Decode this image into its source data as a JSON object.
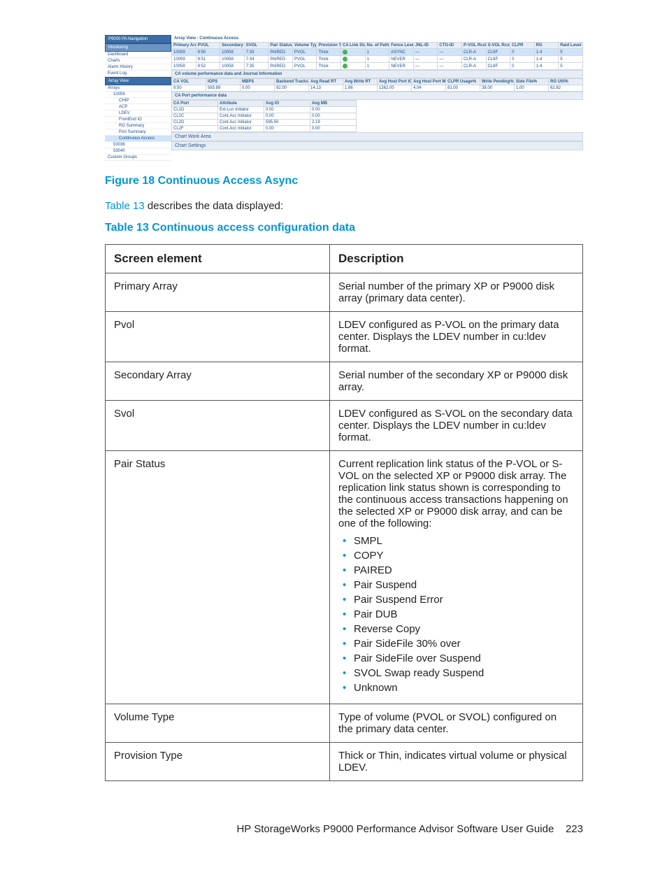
{
  "screenshot": {
    "nav_header": "P9000 PA Navigation",
    "monitoring": "Monitoring",
    "nav_items": [
      "Dashboard",
      "Charts",
      "Alarm History",
      "Event Log"
    ],
    "array_view": "Array View",
    "arrays_label": "Arrays",
    "array_root": "10059",
    "tree": [
      "CHIP",
      "ACP",
      "LDEV",
      "FrontEnd IO",
      "RG Summary",
      "Port Summary"
    ],
    "tree_sel": "Continuous Access",
    "others": [
      "53036",
      "53040"
    ],
    "custom_groups": "Custom Groups",
    "main_title": "Array View - Continuous Access",
    "top_headers": [
      "Primary Array",
      "PVOL",
      "Secondary Array",
      "SVOL",
      "Pair Status",
      "Volume Type",
      "Provision Type",
      "CA Link Status",
      "No. of Paths",
      "Fence Level",
      "JNL-ID",
      "CTG-ID",
      "P-VOL Rcst",
      "S-VOL Rcst",
      "CLPR",
      "RG",
      "Raid Level"
    ],
    "top_rows": [
      [
        "10059",
        "9:50",
        "10058",
        "7:33",
        "PAIRED",
        "PVOL",
        "Thick",
        "OK",
        "1",
        "ASYNC",
        "—",
        "—",
        "CLR-A",
        "CL6F",
        "0",
        "1-4",
        "5"
      ],
      [
        "10059",
        "9:51",
        "10058",
        "7:34",
        "PAIRED",
        "PVOL",
        "Thick",
        "OK",
        "1",
        "NEVER",
        "—",
        "—",
        "CLR-A",
        "CL6F",
        "0",
        "1-4",
        "5"
      ],
      [
        "10059",
        "9:52",
        "10058",
        "7:35",
        "PAIRED",
        "PVOL",
        "Thick",
        "OK",
        "1",
        "NEVER",
        "—",
        "—",
        "CLR-A",
        "CL6F",
        "0",
        "1-4",
        "5"
      ]
    ],
    "vol_title": "CA volume performance data and Journal Information",
    "vol_headers": [
      "CA VOL",
      "IOPS",
      "MBPS",
      "Backend Tracks",
      "Avg Read RT",
      "Avg Write RT",
      "Avg Host Port IO",
      "Avg Host Port MB",
      "CLPR Usage%",
      "Write Pending%",
      "Side File%",
      "RG Util%"
    ],
    "vol_row": [
      "9:50",
      "583.89",
      "0.00",
      "92.00",
      "14.13",
      "1.66",
      "1262.00",
      "4.04",
      "81.00",
      "38.00",
      "1.00",
      "62.82"
    ],
    "port_title": "CA Port performance data",
    "port_headers": [
      "CA Port",
      "Attribute",
      "Avg IO",
      "Avg MB"
    ],
    "port_rows": [
      [
        "CL1D",
        "Ext-Lun Initiator",
        "0.00",
        "0.00"
      ],
      [
        "CL2C",
        "Cont.Acc Initiator",
        "0.00",
        "0.00"
      ],
      [
        "CL2D",
        "Cont.Acc Initiator",
        "595.50",
        "2.19"
      ],
      [
        "CL2F",
        "Cont.Acc Initiator",
        "0.00",
        "0.00"
      ]
    ],
    "chart_work_area": "Chart Work Area",
    "chart_settings": "Chart Settings"
  },
  "figure_caption": "Figure 18 Continuous Access Async",
  "intro_link": "Table 13",
  "intro_rest": " describes the data displayed:",
  "table_caption": "Table 13 Continuous access configuration data",
  "table_head_left": "Screen element",
  "table_head_right": "Description",
  "rows": [
    {
      "name": "Primary Array",
      "desc": "Serial number of the primary XP or P9000 disk array (primary data center)."
    },
    {
      "name": "Pvol",
      "desc": "LDEV configured as P-VOL on the primary data center. Displays the LDEV number in cu:ldev format."
    },
    {
      "name": "Secondary Array",
      "desc": "Serial number of the secondary XP or P9000 disk array."
    },
    {
      "name": "Svol",
      "desc": "LDEV configured as S-VOL on the secondary data center. Displays the LDEV number in cu:ldev format."
    },
    {
      "name": "Pair Status",
      "desc": "Current replication link status of the P-VOL or S-VOL on the selected XP or P9000 disk array. The replication link status shown is corresponding to the continuous access transactions happening on the selected XP or P9000 disk array, and can be one of the following:",
      "items": [
        "SMPL",
        "COPY",
        "PAIRED",
        "Pair Suspend",
        "Pair Suspend Error",
        "Pair DUB",
        "Reverse Copy",
        "Pair SideFile 30% over",
        "Pair SideFile over Suspend",
        "SVOL Swap ready Suspend",
        "Unknown"
      ]
    },
    {
      "name": "Volume Type",
      "desc": "Type of volume (PVOL or SVOL) configured on the primary data center."
    },
    {
      "name": "Provision Type",
      "desc": "Thick or Thin, indicates virtual volume or physical LDEV."
    }
  ],
  "footer_title": "HP StorageWorks P9000 Performance Advisor Software User Guide",
  "footer_page": "223"
}
